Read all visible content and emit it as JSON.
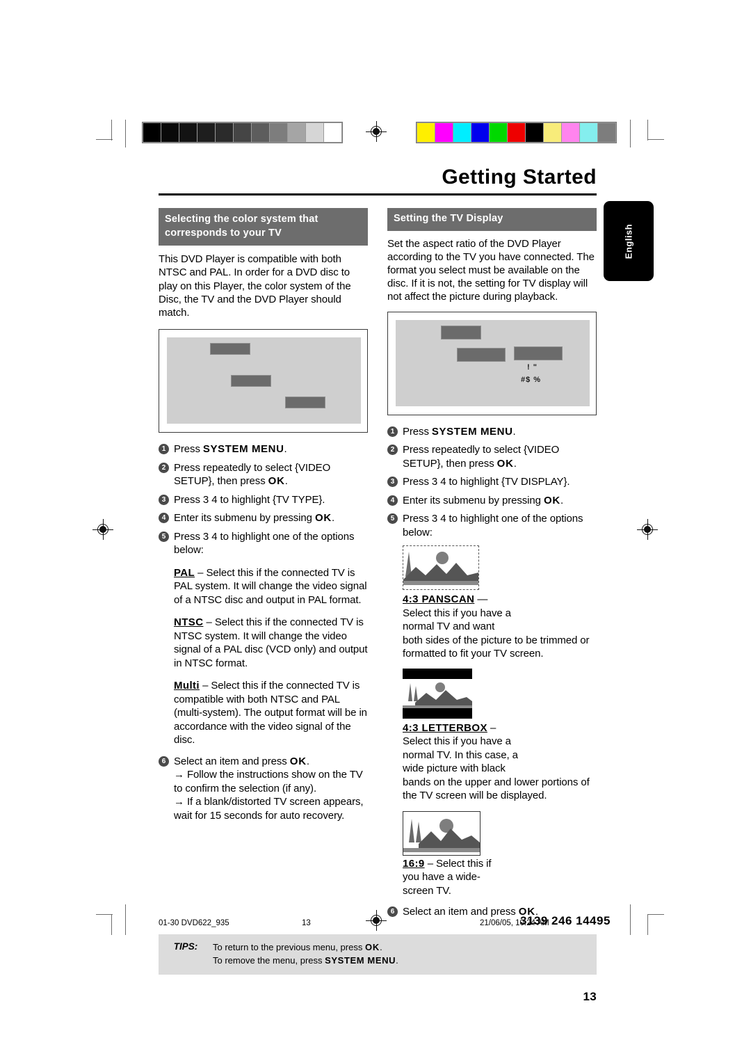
{
  "chapter": {
    "title": "Getting Started"
  },
  "language_tab": {
    "label": "English"
  },
  "left": {
    "heading": "Selecting the color system that corresponds to your TV",
    "intro": "This DVD Player is compatible with both NTSC and PAL. In order for a DVD disc to play on this Player, the color system of the Disc, the TV and the DVD Player should match.",
    "steps": [
      {
        "n": "1",
        "text_before": "Press ",
        "bold": "SYSTEM MENU",
        "text_after": "."
      },
      {
        "n": "2",
        "text_before": "Press     repeatedly to select {VIDEO SETUP}, then press ",
        "bold": "OK",
        "text_after": "."
      },
      {
        "n": "3",
        "text_before": "Press 3 4  to highlight {TV TYPE}.",
        "bold": "",
        "text_after": ""
      },
      {
        "n": "4",
        "text_before": "Enter its submenu by pressing ",
        "bold": "OK",
        "text_after": "."
      },
      {
        "n": "5",
        "text_before": "Press 3 4  to highlight one of the options below:",
        "bold": "",
        "text_after": ""
      }
    ],
    "options": [
      {
        "name": "PAL",
        "desc": " – Select this if the connected TV is PAL system. It will change the video signal of a NTSC disc and output in PAL format."
      },
      {
        "name": "NTSC",
        "desc": " – Select this if the connected TV is NTSC system. It will change the video signal of a PAL disc (VCD only) and output in NTSC format."
      },
      {
        "name": "Multi",
        "desc": " – Select this if the connected TV is compatible with both NTSC and PAL (multi-system). The output format will be in accordance with the video signal of the disc."
      }
    ],
    "final_step": {
      "n": "6",
      "text_before": "Select an item and press ",
      "bold": "OK",
      "text_after": "."
    },
    "notes": [
      "→ Follow the instructions show on the TV to confirm the selection (if any).",
      "→ If a blank/distorted TV screen appears, wait for 15 seconds for auto recovery."
    ]
  },
  "right": {
    "heading": "Setting the TV Display",
    "intro": "Set the aspect ratio of the DVD Player according to the TV you have connected. The format you select must be available on the disc.  If it is not, the setting for TV display will not affect the picture during playback.",
    "osd_line1": "! \"",
    "osd_line2": "#$ %",
    "steps": [
      {
        "n": "1",
        "text_before": "Press ",
        "bold": "SYSTEM MENU",
        "text_after": "."
      },
      {
        "n": "2",
        "text_before": "Press     repeatedly to select {VIDEO SETUP}, then press ",
        "bold": "OK",
        "text_after": "."
      },
      {
        "n": "3",
        "text_before": "Press 3 4  to highlight {TV DISPLAY}.",
        "bold": "",
        "text_after": ""
      },
      {
        "n": "4",
        "text_before": "Enter its submenu by pressing ",
        "bold": "OK",
        "text_after": "."
      },
      {
        "n": "5",
        "text_before": "Press 3 4  to highlight one of the options below:",
        "bold": "",
        "text_after": ""
      }
    ],
    "options": [
      {
        "name": "4:3 PANSCAN",
        "dash": " —",
        "short": "Select this if you have a normal TV and want",
        "rest": "both sides of the picture to be trimmed or formatted to fit your TV screen.",
        "picture": "panscan-illustration"
      },
      {
        "name": "4:3 LETTERBOX",
        "dash": " –",
        "short": "Select this if you have a normal TV. In this case, a wide picture with black",
        "rest": "bands on the upper and lower portions of the TV screen will be displayed.",
        "picture": "letterbox-illustration"
      },
      {
        "name": "16:9",
        "dash": " – Select this if",
        "short": "you have a wide- screen TV.",
        "rest": "",
        "picture": "widescreen-illustration"
      }
    ],
    "final_step": {
      "n": "6",
      "text_before": "Select an item and press ",
      "bold": "OK",
      "text_after": "."
    }
  },
  "tips": {
    "label": "TIPS:",
    "line1_before": "To return to the previous menu, press ",
    "line1_bold": "OK",
    "line1_after": ".",
    "line2_before": "To remove the menu, press ",
    "line2_bold": "SYSTEM MENU",
    "line2_after": "."
  },
  "page_number": "13",
  "footer": {
    "file": "01-30 DVD622_935",
    "page": "13",
    "date": "21/06/05, 10:24 AM",
    "code": "3139 246 14495"
  },
  "print_marks": {
    "grayscale_bar": [
      "#000000",
      "#090909",
      "#131313",
      "#1e1e1e",
      "#2b2b2b",
      "#454545",
      "#5d5d5d",
      "#7d7d7d",
      "#a5a5a5",
      "#d6d6d6",
      "#ffffff"
    ],
    "color_bar": [
      "#ffef00",
      "#ff00ff",
      "#00eeff",
      "#0000ee",
      "#00d900",
      "#ee0000",
      "#000000",
      "#f8ec7a",
      "#ff84ee",
      "#84eeee",
      "#7d7d7d"
    ]
  }
}
